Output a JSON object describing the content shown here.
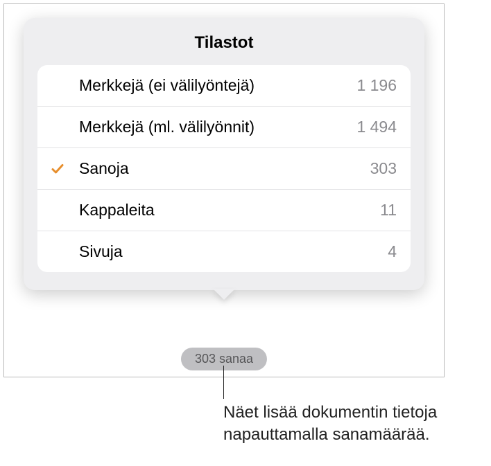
{
  "popover": {
    "title": "Tilastot"
  },
  "stats": [
    {
      "label": "Merkkejä (ei välilyöntejä)",
      "value": "1 196",
      "selected": false
    },
    {
      "label": "Merkkejä (ml. välilyönnit)",
      "value": "1 494",
      "selected": false
    },
    {
      "label": "Sanoja",
      "value": "303",
      "selected": true
    },
    {
      "label": "Kappaleita",
      "value": "11",
      "selected": false
    },
    {
      "label": "Sivuja",
      "value": "4",
      "selected": false
    }
  ],
  "pill": {
    "label": "303 sanaa"
  },
  "callout": {
    "text": "Näet lisää dokumentin tietoja napauttamalla sanamäärää."
  },
  "colors": {
    "accent": "#e78e2c"
  }
}
